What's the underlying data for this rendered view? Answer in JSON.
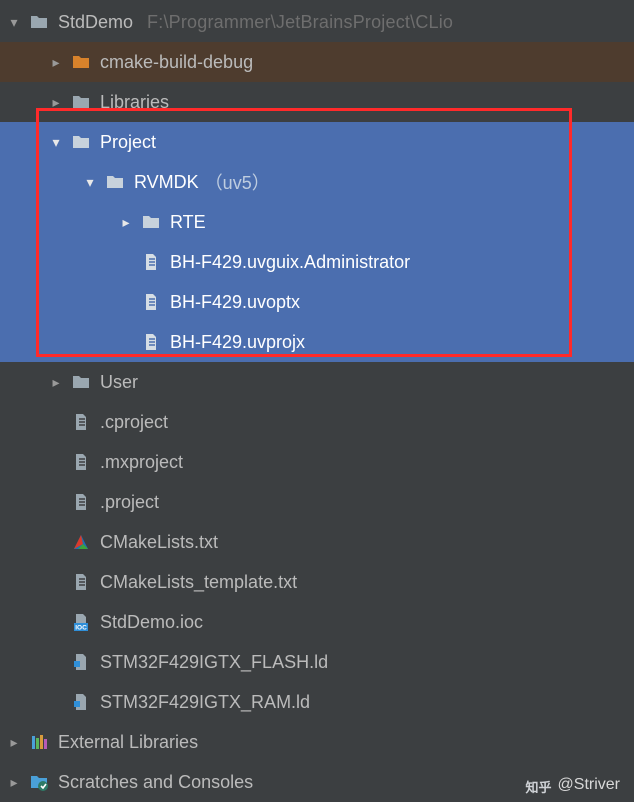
{
  "root": {
    "name": "StdDemo",
    "path_hint": "F:\\Programmer\\JetBrainsProject\\CLio"
  },
  "tree": {
    "cmake_build_debug": "cmake-build-debug",
    "libraries": "Libraries",
    "project": {
      "label": "Project",
      "rvmdk": {
        "label": "RVMDK",
        "suffix": "（uv5）",
        "rte": "RTE",
        "files": [
          "BH-F429.uvguix.Administrator",
          "BH-F429.uvoptx",
          "BH-F429.uvprojx"
        ]
      }
    },
    "user": "User",
    "files": [
      ".cproject",
      ".mxproject",
      ".project",
      "CMakeLists.txt",
      "CMakeLists_template.txt",
      "StdDemo.ioc",
      "STM32F429IGTX_FLASH.ld",
      "STM32F429IGTX_RAM.ld"
    ]
  },
  "external_libraries": "External Libraries",
  "scratches": "Scratches and Consoles",
  "watermark": {
    "site": "知乎",
    "author": "@Striver"
  },
  "colors": {
    "bg": "#3c3f41",
    "selected": "#4b6eaf",
    "folder": "#9aa7b0",
    "folder_orange": "#d8822b",
    "highlight_box": "#ff2a2a"
  }
}
